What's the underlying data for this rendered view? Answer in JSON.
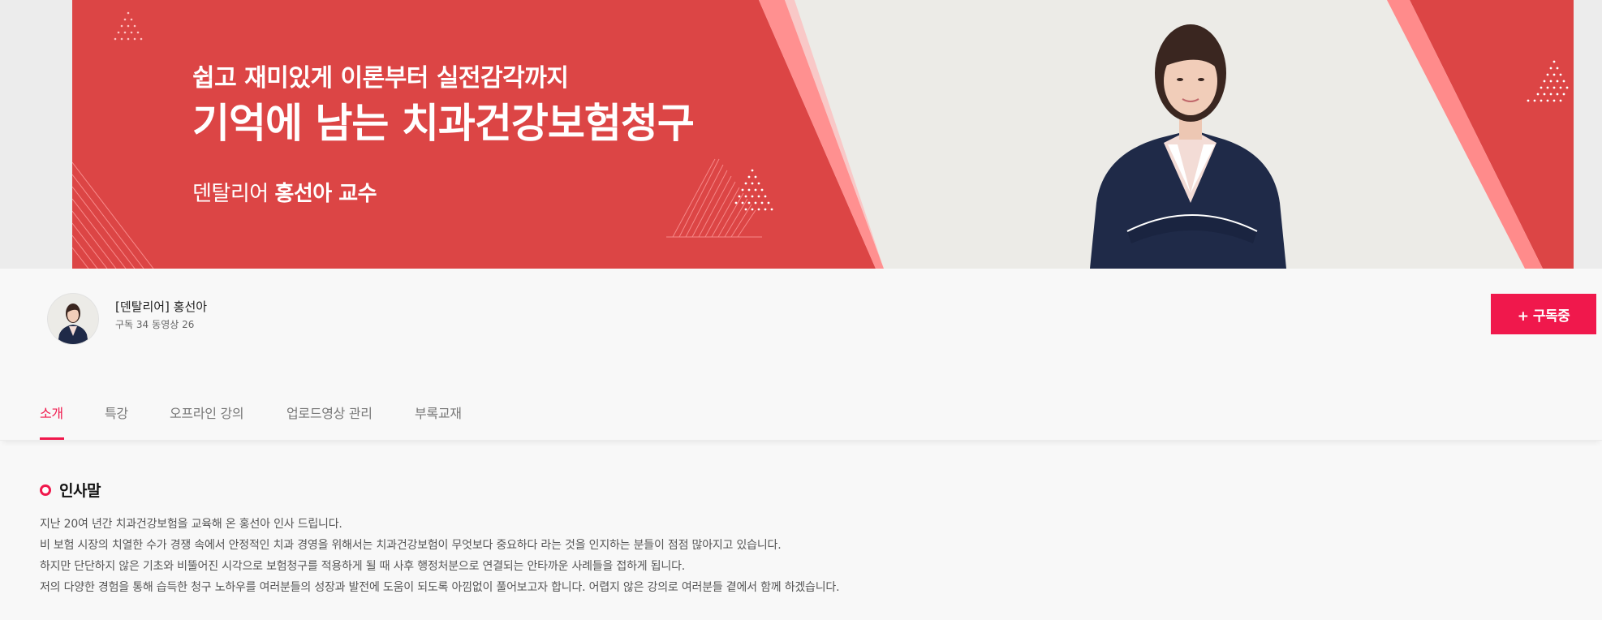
{
  "banner": {
    "subtitle": "쉽고 재미있게 이론부터 실전감각까지",
    "title": "기억에 남는 치과건강보험청구",
    "professor_prefix": "덴탈리어 ",
    "professor_name": "홍선아 교수",
    "colors": {
      "red": "#dc4545",
      "light_red": "#ff8b8b",
      "background": "#ecebe7"
    }
  },
  "channel": {
    "name": "[덴탈리어] 홍선아",
    "subscribers": "구독 34",
    "videos": "동영상 26",
    "subscribe_label": "+ 구독중",
    "accent": "#f0184c"
  },
  "tabs": [
    {
      "label": "소개",
      "active": true
    },
    {
      "label": "특강",
      "active": false
    },
    {
      "label": "오프라인 강의",
      "active": false
    },
    {
      "label": "업로드영상 관리",
      "active": false
    },
    {
      "label": "부록교재",
      "active": false
    }
  ],
  "intro": {
    "title": "인사말",
    "lines": [
      "지난 20여 년간 치과건강보험을 교육해 온 홍선아 인사 드립니다.",
      "비 보험 시장의 치열한 수가 경쟁 속에서 안정적인 치과 경영을 위해서는 치과건강보험이 무엇보다 중요하다 라는 것을 인지하는 분들이 점점 많아지고 있습니다.",
      "하지만 단단하지 않은 기초와 비뚤어진 시각으로 보험청구를 적용하게 될 때 사후 행정처분으로 연결되는 안타까운 사례들을 접하게 됩니다.",
      "저의 다양한 경험을 통해 습득한 청구 노하우를 여러분들의 성장과 발전에 도움이 되도록 아낌없이 풀어보고자 합니다. 어렵지 않은 강의로 여러분들 곁에서 함께 하겠습니다."
    ]
  }
}
